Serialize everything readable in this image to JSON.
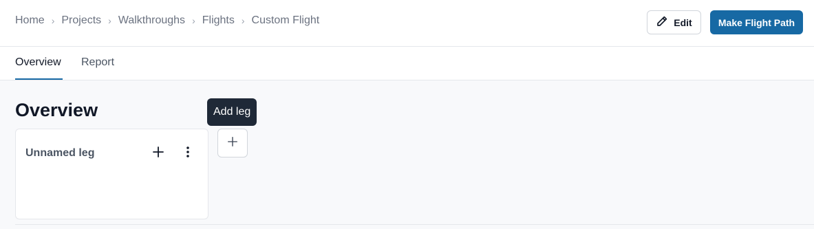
{
  "breadcrumb": [
    "Home",
    "Projects",
    "Walkthroughs",
    "Flights",
    "Custom Flight"
  ],
  "breadcrumb_separator": "›",
  "header": {
    "edit_label": "Edit",
    "edit_icon": "pencil-icon",
    "primary_label": "Make Flight Path",
    "primary_color": "#1769a4"
  },
  "tabs": [
    {
      "label": "Overview",
      "active": true
    },
    {
      "label": "Report",
      "active": false
    }
  ],
  "main": {
    "title": "Overview",
    "legs": [
      {
        "name": "Unnamed leg",
        "add_icon": "plus-icon",
        "menu_icon": "more-vertical-icon"
      }
    ],
    "add_leg_icon": "plus-icon",
    "tooltip": "Add leg"
  }
}
